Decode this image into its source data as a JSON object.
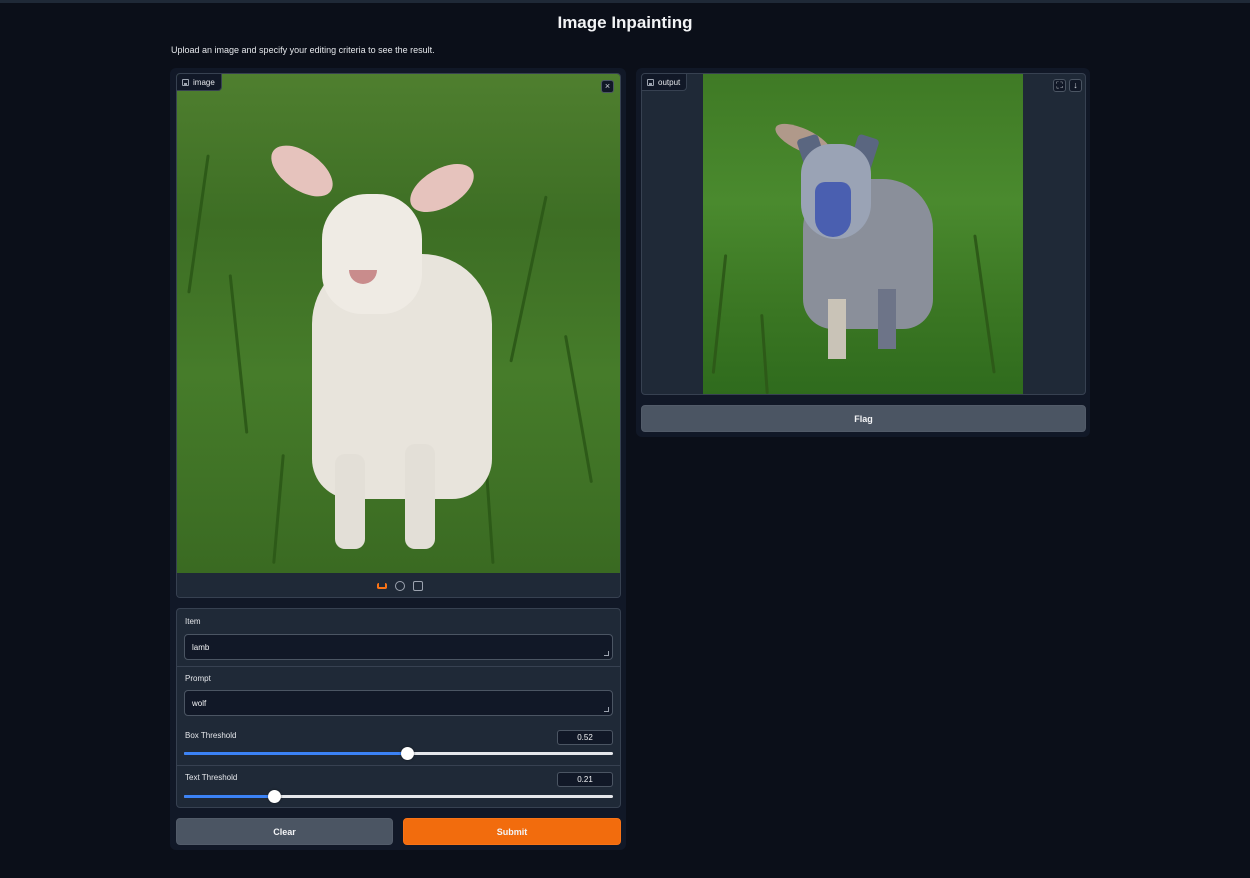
{
  "page": {
    "title": "Image Inpainting",
    "description": "Upload an image and specify your editing criteria to see the result."
  },
  "input_image": {
    "label": "image",
    "clear_icon": "close-icon",
    "sources": [
      "upload-icon",
      "webcam-icon",
      "clipboard-icon"
    ]
  },
  "form": {
    "item_label": "Item",
    "item_value": "lamb",
    "prompt_label": "Prompt",
    "prompt_value": "wolf",
    "box_threshold_label": "Box Threshold",
    "box_threshold_value": "0.52",
    "box_threshold_fraction": 0.52,
    "text_threshold_label": "Text Threshold",
    "text_threshold_value": "0.21",
    "text_threshold_fraction": 0.21
  },
  "buttons": {
    "clear_label": "Clear",
    "submit_label": "Submit",
    "flag_label": "Flag"
  },
  "output": {
    "label": "output",
    "icons": [
      "fullscreen-icon",
      "download-icon"
    ]
  },
  "colors": {
    "background": "#0b0f19",
    "panel": "#111827",
    "accent": "#f26c0d",
    "slider": "#3b82f6"
  }
}
